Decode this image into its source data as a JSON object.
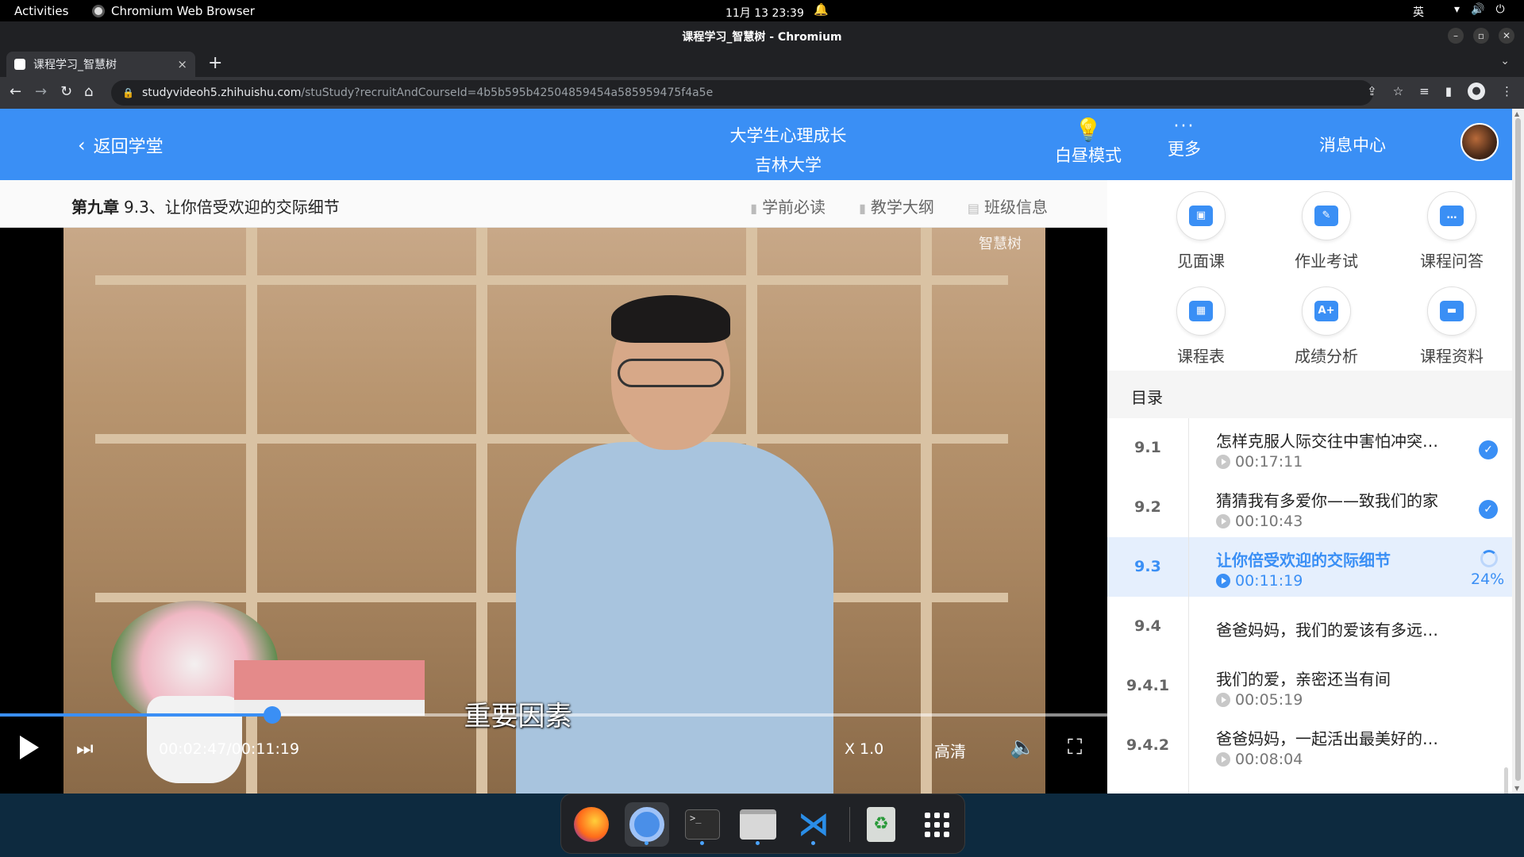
{
  "system": {
    "activities": "Activities",
    "app_name": "Chromium Web Browser",
    "clock": "11月 13  23:39",
    "ime": "英"
  },
  "window": {
    "title": "课程学习_智慧树 - Chromium"
  },
  "tab": {
    "title": "课程学习_智慧树",
    "close": "×",
    "new_tab": "+"
  },
  "url": {
    "host": "studyvideoh5.zhihuishu.com",
    "path": "/stuStudy?recruitAndCourseId=4b5b595b42504859454a585959475f4a5e"
  },
  "header": {
    "back_label": "返回学堂",
    "course_name": "大学生心理成长",
    "school": "吉林大学",
    "day_mode": "白昼模式",
    "more": "更多",
    "messages": "消息中心"
  },
  "chapter": {
    "prefix": "第九章",
    "title": "9.3、让你倍受欢迎的交际细节",
    "links": [
      "学前必读",
      "教学大纲",
      "班级信息"
    ]
  },
  "video": {
    "watermark": "智慧树",
    "subtitle": "重要因素",
    "time": "00:02:47/00:11:19",
    "progress": 0.246,
    "speed": "X 1.0",
    "quality": "高清"
  },
  "tools": [
    {
      "label": "见面课",
      "icon": "meeting-icon"
    },
    {
      "label": "作业考试",
      "icon": "homework-icon"
    },
    {
      "label": "课程问答",
      "icon": "qa-icon"
    },
    {
      "label": "课程表",
      "icon": "schedule-icon"
    },
    {
      "label": "成绩分析",
      "icon": "grade-icon"
    },
    {
      "label": "课程资料",
      "icon": "folder-icon"
    }
  ],
  "directory": {
    "label": "目录",
    "lessons": [
      {
        "num": "9.1",
        "title": "怎样克服人际交往中害怕冲突…",
        "duration": "00:17:11",
        "status": "done"
      },
      {
        "num": "9.2",
        "title": "猜猜我有多爱你——致我们的家",
        "duration": "00:10:43",
        "status": "done"
      },
      {
        "num": "9.3",
        "title": "让你倍受欢迎的交际细节",
        "duration": "00:11:19",
        "status": "active",
        "percent": "24%"
      },
      {
        "num": "9.4",
        "title": "爸爸妈妈，我们的爱该有多远…",
        "duration": "",
        "status": "none"
      },
      {
        "num": "9.4.1",
        "title": "我们的爱，亲密还当有间",
        "duration": "00:05:19",
        "status": "none"
      },
      {
        "num": "9.4.2",
        "title": "爸爸妈妈，一起活出最美好的…",
        "duration": "00:08:04",
        "status": "none"
      }
    ]
  },
  "colors": {
    "accent": "#3a8ff5",
    "header_bg": "#3a8ff5",
    "active_row_bg": "#e5effd"
  }
}
